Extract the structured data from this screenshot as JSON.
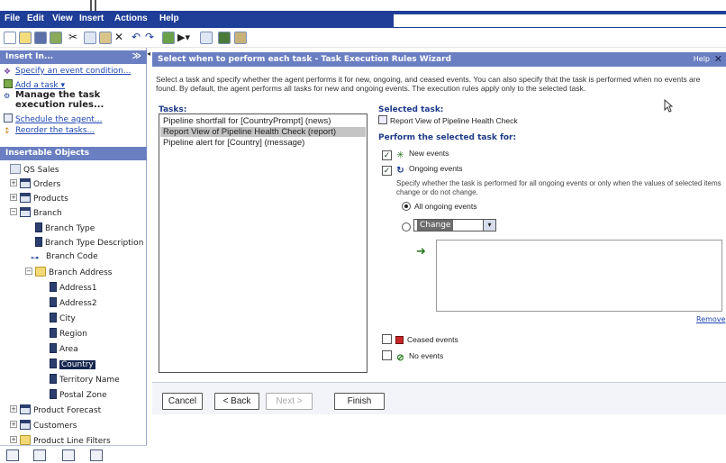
{
  "menubar": {
    "items": [
      "File",
      "Edit",
      "View",
      "Insert",
      "Actions",
      "Help"
    ]
  },
  "toolbar": {
    "icons": [
      "new-icon",
      "open-icon",
      "save-icon",
      "properties-icon",
      "cut-icon",
      "copy-icon",
      "paste-icon",
      "delete-icon",
      "undo-icon",
      "redo-icon",
      "chart-icon",
      "run-icon",
      "grid-icon",
      "table-icon"
    ]
  },
  "insert_pane": {
    "title": "Insert In...",
    "links": [
      {
        "icon": "event-icon",
        "label": "Specify an event condition..."
      },
      {
        "icon": "task-icon",
        "label": "Add a task ▾"
      },
      {
        "icon": "rules-icon",
        "label": "Manage the task execution rules..."
      },
      {
        "icon": "schedule-icon",
        "label": "Schedule the agent..."
      },
      {
        "icon": "reorder-icon",
        "label": "Reorder the tasks..."
      }
    ]
  },
  "objects_pane": {
    "title": "Insertable Objects",
    "tree": [
      {
        "label": "QS Sales",
        "icon": "package-icon",
        "level": 0,
        "expander": ""
      },
      {
        "label": "Orders",
        "icon": "table-icon",
        "level": 1,
        "expander": "+"
      },
      {
        "label": "Products",
        "icon": "table-icon",
        "level": 1,
        "expander": "+"
      },
      {
        "label": "Branch",
        "icon": "table-icon",
        "level": 1,
        "expander": "−"
      },
      {
        "label": "Branch Type",
        "icon": "attribute-icon",
        "level": 2,
        "expander": ""
      },
      {
        "label": "Branch Type Description",
        "icon": "attribute-icon",
        "level": 2,
        "expander": ""
      },
      {
        "label": "Branch Code",
        "icon": "key-icon",
        "level": 2,
        "expander": ""
      },
      {
        "label": "Branch Address",
        "icon": "folder-icon",
        "level": 2,
        "expander": "−"
      },
      {
        "label": "Address1",
        "icon": "attribute-icon",
        "level": 3,
        "expander": ""
      },
      {
        "label": "Address2",
        "icon": "attribute-icon",
        "level": 3,
        "expander": ""
      },
      {
        "label": "City",
        "icon": "attribute-icon",
        "level": 3,
        "expander": ""
      },
      {
        "label": "Region",
        "icon": "attribute-icon",
        "level": 3,
        "expander": ""
      },
      {
        "label": "Area",
        "icon": "attribute-icon",
        "level": 3,
        "expander": ""
      },
      {
        "label": "Country",
        "icon": "attribute-icon",
        "level": 3,
        "expander": "",
        "selected": true
      },
      {
        "label": "Territory Name",
        "icon": "attribute-icon",
        "level": 3,
        "expander": ""
      },
      {
        "label": "Postal Zone",
        "icon": "attribute-icon",
        "level": 3,
        "expander": ""
      },
      {
        "label": "Product Forecast",
        "icon": "table-icon",
        "level": 1,
        "expander": "+"
      },
      {
        "label": "Customers",
        "icon": "table-icon",
        "level": 1,
        "expander": "+"
      },
      {
        "label": "Product Line Filters",
        "icon": "folder-icon",
        "level": 1,
        "expander": "+"
      }
    ],
    "bottom_icons": [
      "source-tab-icon",
      "data-items-tab-icon",
      "functions-tab-icon",
      "history-tab-icon"
    ]
  },
  "wizard": {
    "title": "Select when to perform each task - Task Execution Rules Wizard",
    "help": "Help",
    "intro": "Select a task and specify whether the agent performs it for new, ongoing, and ceased events. You can also specify that the task is performed when no events are found. By default, the agent performs all tasks for new and ongoing events. The execution rules apply only to the selected task.",
    "tasks_label": "Tasks:",
    "tasks": [
      "Pipeline shortfall for [CountryPrompt] (news)",
      "Report View of Pipeline Health Check (report)",
      "Pipeline alert for [Country] (message)"
    ],
    "selected_task_index": 1,
    "selected_task_label": "Selected task:",
    "selected_task_value": "Report View of Pipeline Health Check",
    "perform_label": "Perform the selected task for:",
    "new_events": {
      "label": "New events",
      "checked": true
    },
    "ongoing_events": {
      "label": "Ongoing events",
      "checked": true
    },
    "ongoing_help": "Specify whether the task is performed for all ongoing events or only when the values of selected items change or do not change.",
    "all_ongoing": {
      "label": "All ongoing events",
      "selected": true
    },
    "change_option": {
      "value": "Change",
      "selected": false
    },
    "remove_label": "Remove",
    "ceased_events": {
      "label": "Ceased events",
      "checked": false
    },
    "no_events": {
      "label": "No events",
      "checked": false
    }
  },
  "buttons": {
    "cancel": "Cancel",
    "back": "< Back",
    "next": "Next >",
    "finish": "Finish"
  }
}
